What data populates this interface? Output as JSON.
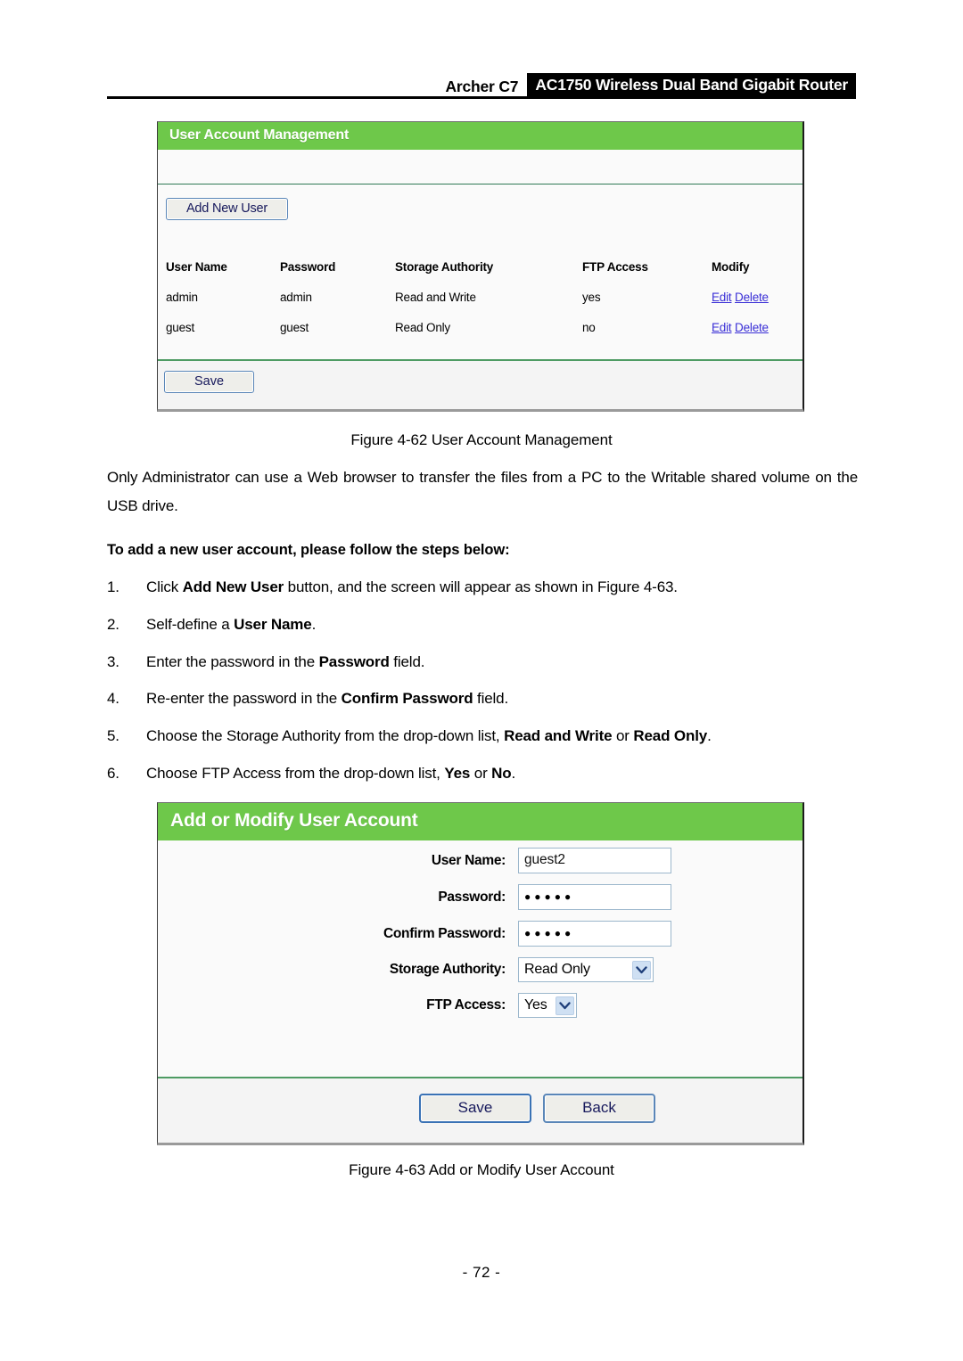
{
  "header": {
    "model": "Archer C7",
    "product": "AC1750 Wireless Dual Band Gigabit Router"
  },
  "panel_users": {
    "title": "User Account Management",
    "add_button": "Add New User",
    "save_button": "Save",
    "columns": [
      "User Name",
      "Password",
      "Storage Authority",
      "FTP Access",
      "Modify"
    ],
    "rows": [
      {
        "user_name": "admin",
        "password": "admin",
        "storage_authority": "Read and Write",
        "ftp_access": "yes",
        "edit": "Edit",
        "delete": "Delete"
      },
      {
        "user_name": "guest",
        "password": "guest",
        "storage_authority": "Read Only",
        "ftp_access": "no",
        "edit": "Edit",
        "delete": "Delete"
      }
    ]
  },
  "figure_62_caption": "Figure 4-62 User Account Management",
  "body_paragraph": "Only Administrator can use a Web browser to transfer the files from a PC to the Writable shared volume on the USB drive.",
  "steps_heading": "To add a new user account, please follow the steps below:",
  "steps": [
    {
      "number": "1.",
      "parts": [
        {
          "text": "Click ",
          "bold": false
        },
        {
          "text": "Add New User",
          "bold": true
        },
        {
          "text": " button, and the screen will appear as shown in Figure 4-63.",
          "bold": false
        }
      ]
    },
    {
      "number": "2.",
      "parts": [
        {
          "text": "Self-define a ",
          "bold": false
        },
        {
          "text": "User Name",
          "bold": true
        },
        {
          "text": ".",
          "bold": false
        }
      ]
    },
    {
      "number": "3.",
      "parts": [
        {
          "text": "Enter the password in the ",
          "bold": false
        },
        {
          "text": "Password",
          "bold": true
        },
        {
          "text": " field.",
          "bold": false
        }
      ]
    },
    {
      "number": "4.",
      "parts": [
        {
          "text": "Re-enter the password in the ",
          "bold": false
        },
        {
          "text": "Confirm Password",
          "bold": true
        },
        {
          "text": " field.",
          "bold": false
        }
      ]
    },
    {
      "number": "5.",
      "parts": [
        {
          "text": "Choose the Storage Authority from the drop-down list, ",
          "bold": false
        },
        {
          "text": "Read and Write",
          "bold": true
        },
        {
          "text": " or ",
          "bold": false
        },
        {
          "text": "Read Only",
          "bold": true
        },
        {
          "text": ".",
          "bold": false
        }
      ]
    },
    {
      "number": "6.",
      "parts": [
        {
          "text": "Choose FTP Access from the drop-down list, ",
          "bold": false
        },
        {
          "text": "Yes",
          "bold": true
        },
        {
          "text": " or ",
          "bold": false
        },
        {
          "text": "No",
          "bold": true
        },
        {
          "text": ".",
          "bold": false
        }
      ]
    }
  ],
  "panel_add": {
    "title": "Add or Modify User Account",
    "fields": {
      "user_name_label": "User Name:",
      "user_name_value": "guest2",
      "password_label": "Password:",
      "password_value": "●●●●●",
      "confirm_password_label": "Confirm Password:",
      "confirm_password_value": "●●●●●",
      "storage_authority_label": "Storage Authority:",
      "storage_authority_value": "Read Only",
      "ftp_access_label": "FTP Access:",
      "ftp_access_value": "Yes"
    },
    "save_button": "Save",
    "back_button": "Back"
  },
  "figure_63_caption": "Figure 4-63 Add or Modify User Account",
  "page_number": "- 72 -",
  "colors": {
    "panel_green": "#6ec84a",
    "rule_green": "#4e9b63",
    "link_blue": "#3a2fd6",
    "header_black": "#000000"
  }
}
